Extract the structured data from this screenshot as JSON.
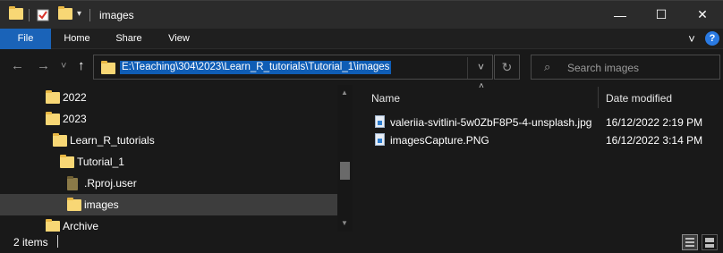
{
  "window": {
    "title": "images",
    "minimize_glyph": "—",
    "maximize_glyph": "☐",
    "close_glyph": "✕"
  },
  "ribbon": {
    "tabs": [
      "File",
      "Home",
      "Share",
      "View"
    ],
    "expand_glyph": "˅",
    "help_glyph": "?"
  },
  "nav": {
    "back_glyph": "←",
    "forward_glyph": "→",
    "recent_glyph": "˅",
    "up_glyph": "↑",
    "address": "E:\\Teaching\\304\\2023\\Learn_R_tutorials\\Tutorial_1\\images",
    "address_dropdown_glyph": "˅",
    "refresh_glyph": "↻",
    "search_placeholder": "Search images",
    "search_glyph": "⌕"
  },
  "tree": [
    {
      "label": "2022",
      "indent": 1,
      "dim": false,
      "selected": false
    },
    {
      "label": "2023",
      "indent": 1,
      "dim": false,
      "selected": false
    },
    {
      "label": "Learn_R_tutorials",
      "indent": 2,
      "dim": false,
      "selected": false
    },
    {
      "label": "Tutorial_1",
      "indent": 3,
      "dim": false,
      "selected": false
    },
    {
      "label": ".Rproj.user",
      "indent": 4,
      "dim": true,
      "selected": false
    },
    {
      "label": "images",
      "indent": 4,
      "dim": false,
      "selected": true
    },
    {
      "label": "Archive",
      "indent": 1,
      "dim": false,
      "selected": false
    }
  ],
  "content": {
    "sort_glyph": "˄",
    "columns": {
      "name": "Name",
      "date": "Date modified"
    },
    "files": [
      {
        "name": "valeriia-svitlini-5w0ZbF8P5-4-unsplash.jpg",
        "date": "16/12/2022 2:19 PM"
      },
      {
        "name": "imagesCapture.PNG",
        "date": "16/12/2022 3:14 PM"
      }
    ]
  },
  "status": {
    "item_count": "2 items"
  },
  "colors": {
    "accent": "#1a63b8",
    "selection": "#0f5db5",
    "folder": "#f8d775",
    "background": "#191919"
  }
}
